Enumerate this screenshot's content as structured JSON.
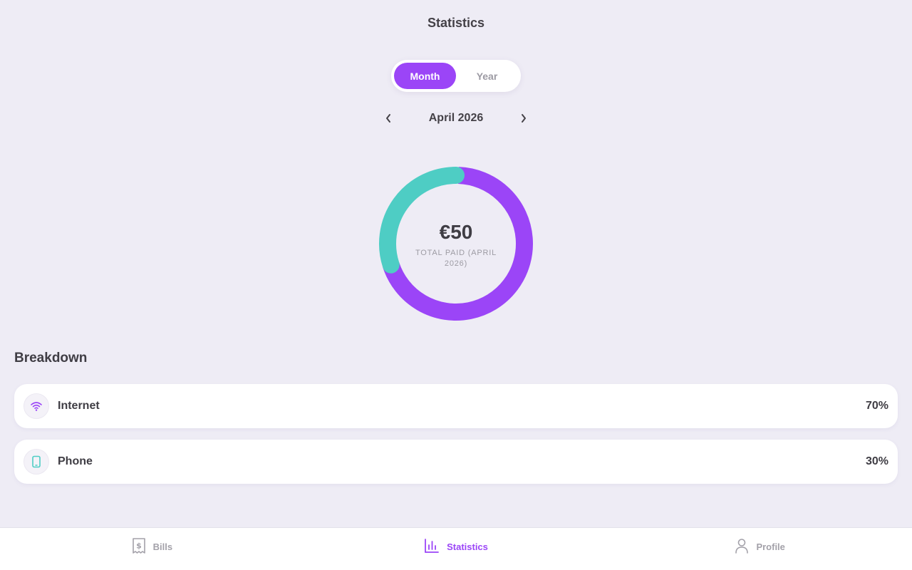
{
  "header": {
    "title": "Statistics"
  },
  "period_toggle": {
    "options": [
      "Month",
      "Year"
    ],
    "selected": "Month"
  },
  "period_nav": {
    "label": "April 2026",
    "prev_icon": "chevron-left-icon",
    "next_icon": "chevron-right-icon"
  },
  "summary": {
    "total": "€50",
    "caption": "TOTAL PAID (APRIL 2026)"
  },
  "colors": {
    "accent": "#9b45f7",
    "teal": "#4ecdc4",
    "background": "#eeecf5"
  },
  "chart_data": {
    "type": "pie",
    "categories": [
      "Internet",
      "Phone"
    ],
    "values": [
      70,
      30
    ],
    "colors": [
      "#9b45f7",
      "#4ecdc4"
    ]
  },
  "breakdown": {
    "title": "Breakdown",
    "items": [
      {
        "name": "Internet",
        "percent": "70%",
        "icon": "wifi-icon"
      },
      {
        "name": "Phone",
        "percent": "30%",
        "icon": "phone-icon"
      }
    ]
  },
  "tabs": [
    {
      "label": "Bills",
      "icon": "bill-icon",
      "active": false
    },
    {
      "label": "Statistics",
      "icon": "bar-chart-icon",
      "active": true
    },
    {
      "label": "Profile",
      "icon": "person-icon",
      "active": false
    }
  ]
}
